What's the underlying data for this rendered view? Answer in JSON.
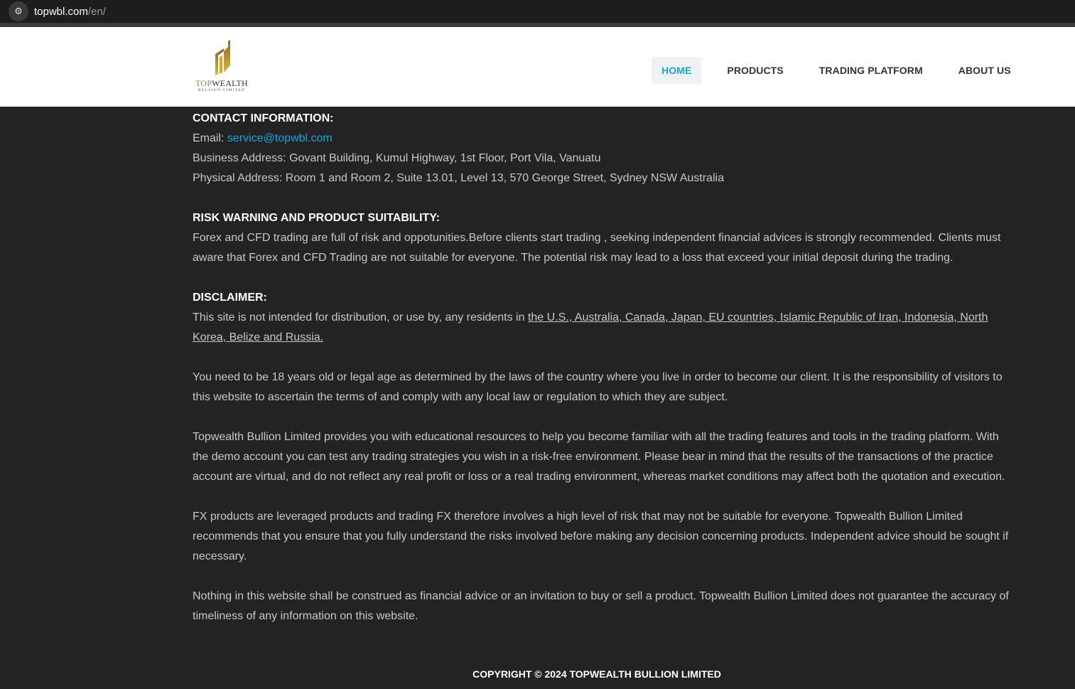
{
  "browser": {
    "url_host": "topwbl.com",
    "url_path": "/en/"
  },
  "logo": {
    "top": "TOP",
    "wealth": "WEALTH",
    "sub": "BULLION LIMITED"
  },
  "nav": [
    {
      "label": "HOME"
    },
    {
      "label": "PRODUCTS"
    },
    {
      "label": "TRADING PLATFORM"
    },
    {
      "label": "ABOUT US"
    }
  ],
  "contact": {
    "heading": "CONTACT INFORMATION:",
    "email_label": "Email: ",
    "email": "service@topwbl.com",
    "business": "Business Address: Govant Building, Kumul Highway, 1st Floor, Port Vila, Vanuatu",
    "physical": "Physical Address: Room 1 and Room 2, Suite 13.01, Level 13, 570 George Street, Sydney NSW Australia"
  },
  "risk": {
    "heading": "RISK WARNING AND PRODUCT SUITABILITY:",
    "text": "Forex and CFD trading are full of risk and oppotunities.Before clients start trading , seeking independent financial advices is strongly recommended. Clients must aware that Forex and CFD Trading are not suitable for everyone. The potential risk may lead to a loss that exceed your initial deposit during the trading."
  },
  "disclaimer": {
    "heading": "DISCLAIMER:",
    "intro": "This site is not intended for distribution, or use by, any residents in ",
    "countries": "the U.S., Australia, Canada, Japan, EU countries, Islamic Republic of Iran, Indonesia, North Korea, Belize and Russia.",
    "p1": "You need to be 18 years old or legal age as determined by the laws of the country where you live in order to become our client. It is the responsibility of visitors to this website to ascertain the terms of and comply with any local law or regulation to which they are subject.",
    "p2": "Topwealth Bullion Limited provides you with educational resources to help you become familiar with all the trading features and tools in the trading platform. With the demo account you can test any trading strategies you wish in a risk-free environment. Please bear in mind that the results of the transactions of the practice account are virtual, and do not reflect any real profit or loss or a real trading environment, whereas market conditions may affect both the quotation and execution.",
    "p3": "FX products are leveraged products and trading FX therefore involves a high level of risk that may not be suitable for everyone. Topwealth Bullion Limited recommends that you ensure that you fully understand the risks involved before making any decision concerning products. Independent advice should be sought if necessary.",
    "p4": "Nothing in this website shall be construed as financial advice or an invitation to buy or sell a product. Topwealth Bullion Limited does not guarantee the accuracy of timeliness of any information on this website."
  },
  "footer": {
    "copyright": "COPYRIGHT © 2024 TOPWEALTH BULLION LIMITED"
  }
}
